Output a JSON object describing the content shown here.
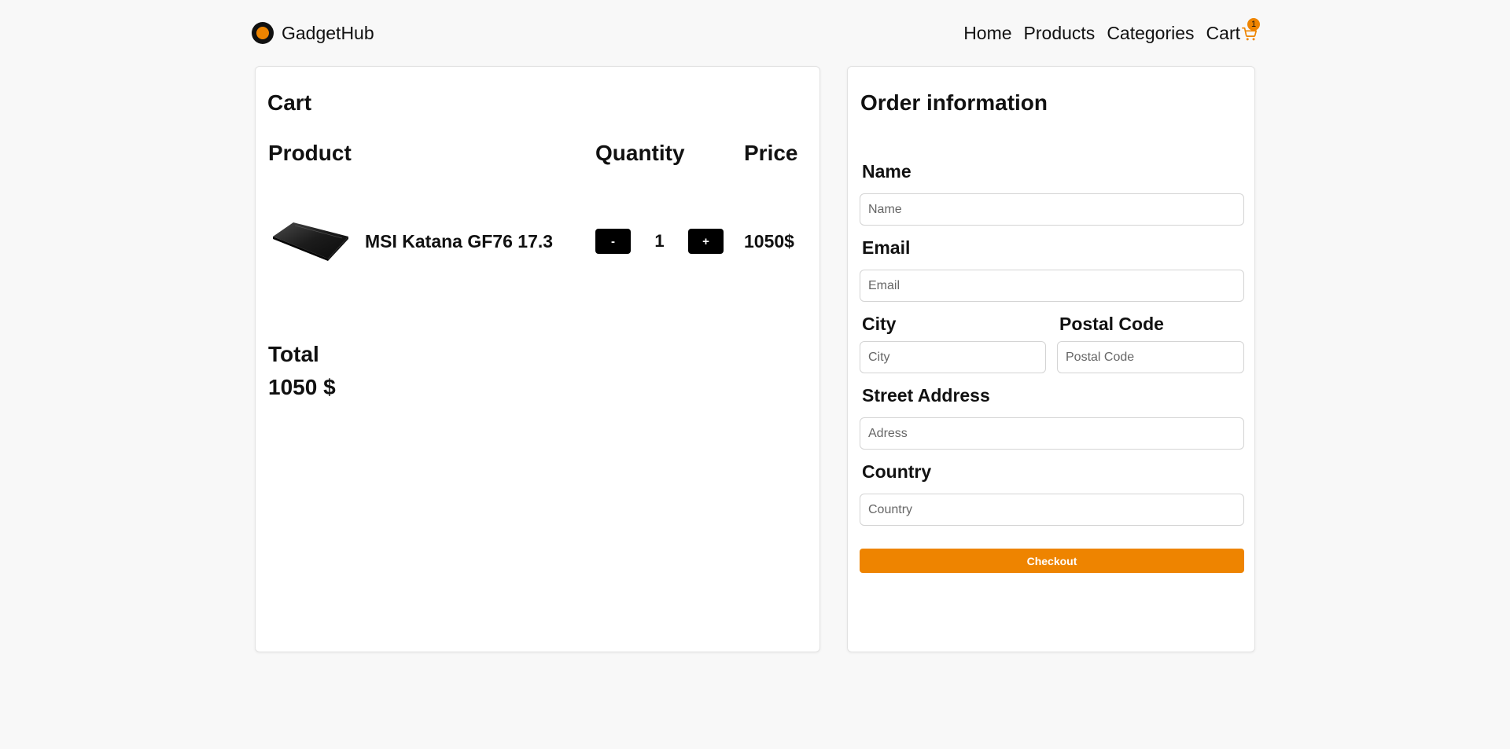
{
  "header": {
    "brand": "GadgetHub",
    "nav": {
      "home": "Home",
      "products": "Products",
      "categories": "Categories",
      "cart": "Cart"
    },
    "cart_count": "1"
  },
  "cart": {
    "title": "Cart",
    "columns": {
      "product": "Product",
      "quantity": "Quantity",
      "price": "Price"
    },
    "items": [
      {
        "name": "MSI Katana GF76 17.3",
        "quantity": "1",
        "price": "1050$",
        "minus_label": "-",
        "plus_label": "+"
      }
    ],
    "total_label": "Total",
    "total_value": "1050 $"
  },
  "order": {
    "title": "Order information",
    "fields": {
      "name": {
        "label": "Name",
        "placeholder": "Name"
      },
      "email": {
        "label": "Email",
        "placeholder": "Email"
      },
      "city": {
        "label": "City",
        "placeholder": "City"
      },
      "postal_code": {
        "label": "Postal Code",
        "placeholder": "Postal Code"
      },
      "street": {
        "label": "Street Address",
        "placeholder": "Adress"
      },
      "country": {
        "label": "Country",
        "placeholder": "Country"
      }
    },
    "checkout_label": "Checkout"
  },
  "colors": {
    "accent": "#ee8400",
    "button_dark": "#000000",
    "background": "#f8f8f8"
  },
  "icons": {
    "logo": "brand-logo-icon",
    "cart": "cart-icon"
  }
}
